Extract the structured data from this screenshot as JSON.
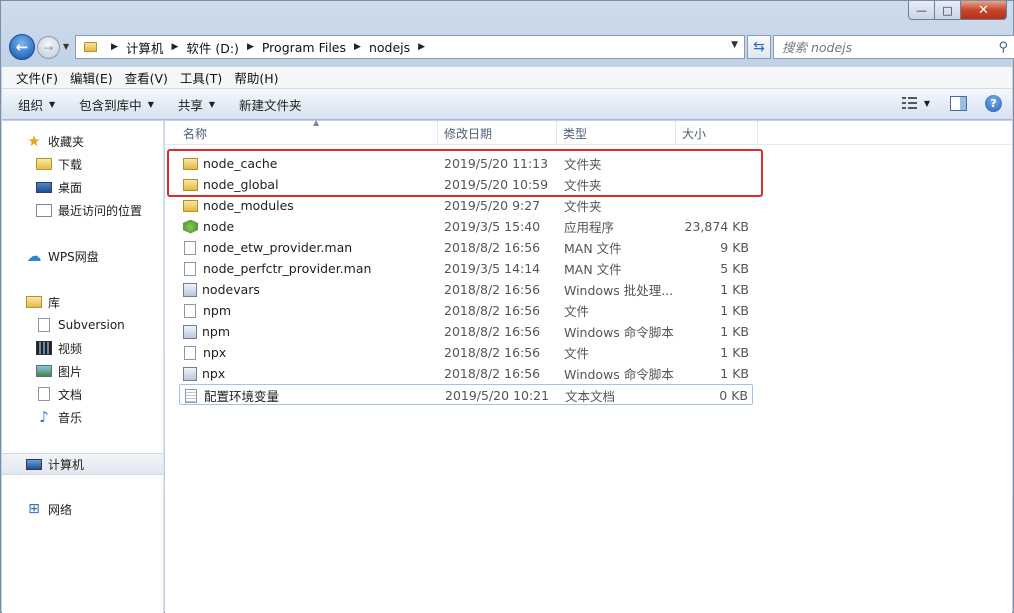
{
  "window": {
    "minimize_glyph": "—",
    "maximize_glyph": "□",
    "close_glyph": "✕"
  },
  "nav": {
    "back_glyph": "←",
    "forward_glyph": "→",
    "breadcrumbs": [
      "计算机",
      "软件 (D:)",
      "Program Files",
      "nodejs"
    ],
    "search_placeholder": "搜索 nodejs"
  },
  "menubar": [
    "文件(F)",
    "编辑(E)",
    "查看(V)",
    "工具(T)",
    "帮助(H)"
  ],
  "toolbar": {
    "organize": "组织",
    "include_in_library": "包含到库中",
    "share": "共享",
    "new_folder": "新建文件夹"
  },
  "navpane": {
    "favorites": "收藏夹",
    "downloads": "下载",
    "desktop": "桌面",
    "recent": "最近访问的位置",
    "wps": "WPS网盘",
    "libraries": "库",
    "subversion": "Subversion",
    "videos": "视频",
    "pictures": "图片",
    "documents": "文档",
    "music": "音乐",
    "computer": "计算机",
    "network": "网络"
  },
  "columns": {
    "name": "名称",
    "date": "修改日期",
    "type": "类型",
    "size": "大小"
  },
  "files": [
    {
      "name": "node_cache",
      "date": "2019/5/20 11:13",
      "type": "文件夹",
      "size": "",
      "icon": "folder"
    },
    {
      "name": "node_global",
      "date": "2019/5/20 10:59",
      "type": "文件夹",
      "size": "",
      "icon": "folder"
    },
    {
      "name": "node_modules",
      "date": "2019/5/20 9:27",
      "type": "文件夹",
      "size": "",
      "icon": "folder"
    },
    {
      "name": "node",
      "date": "2019/3/5 15:40",
      "type": "应用程序",
      "size": "23,874 KB",
      "icon": "node-app"
    },
    {
      "name": "node_etw_provider.man",
      "date": "2018/8/2 16:56",
      "type": "MAN 文件",
      "size": "9 KB",
      "icon": "file"
    },
    {
      "name": "node_perfctr_provider.man",
      "date": "2019/3/5 14:14",
      "type": "MAN 文件",
      "size": "5 KB",
      "icon": "file"
    },
    {
      "name": "nodevars",
      "date": "2018/8/2 16:56",
      "type": "Windows 批处理...",
      "size": "1 KB",
      "icon": "batch"
    },
    {
      "name": "npm",
      "date": "2018/8/2 16:56",
      "type": "文件",
      "size": "1 KB",
      "icon": "file"
    },
    {
      "name": "npm",
      "date": "2018/8/2 16:56",
      "type": "Windows 命令脚本",
      "size": "1 KB",
      "icon": "batch"
    },
    {
      "name": "npx",
      "date": "2018/8/2 16:56",
      "type": "文件",
      "size": "1 KB",
      "icon": "file"
    },
    {
      "name": "npx",
      "date": "2018/8/2 16:56",
      "type": "Windows 命令脚本",
      "size": "1 KB",
      "icon": "batch"
    },
    {
      "name": "配置环境变量",
      "date": "2019/5/20 10:21",
      "type": "文本文档",
      "size": "0 KB",
      "icon": "text"
    }
  ],
  "colors": {
    "highlight_border": "#e02b2b",
    "selection_border": "#a5c1e3"
  }
}
